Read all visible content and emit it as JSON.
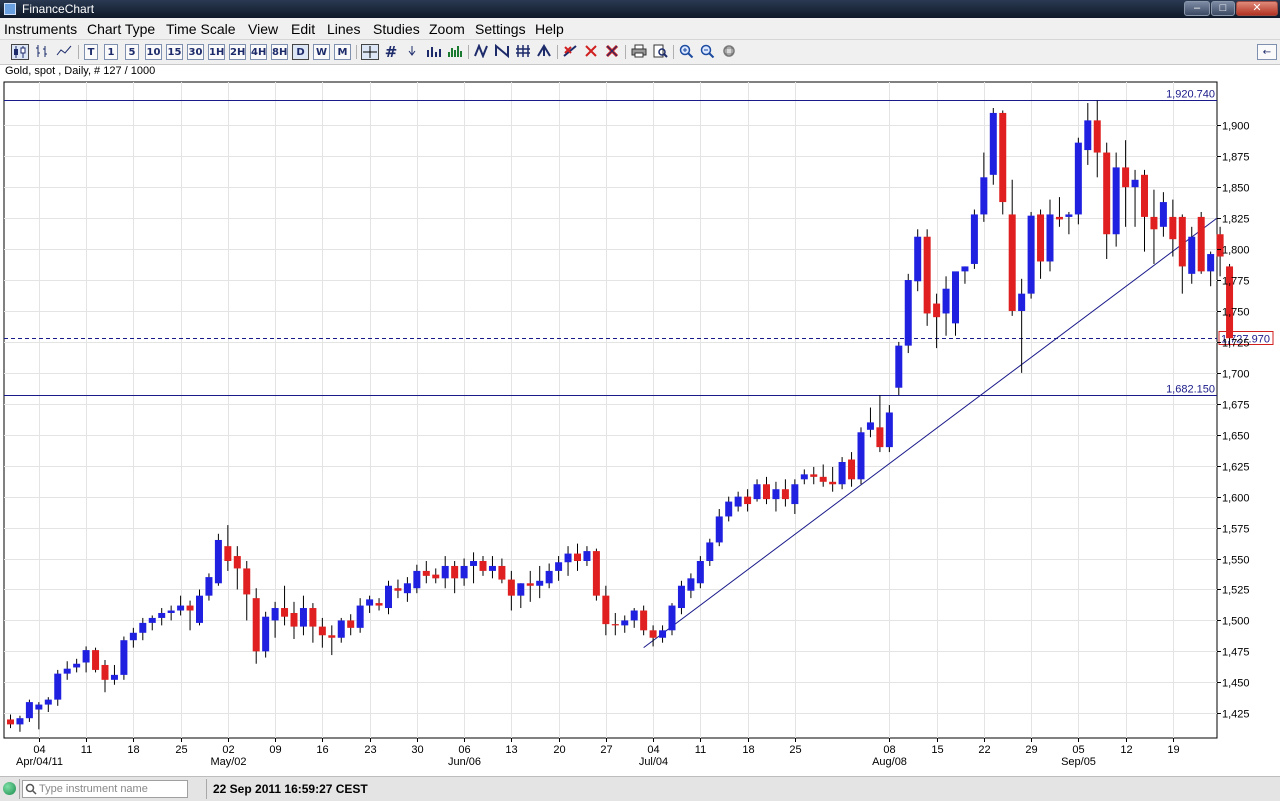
{
  "app": {
    "title": "FinanceChart"
  },
  "window_controls": {
    "minimize": "‒",
    "maximize": "□",
    "close": "✕"
  },
  "menu": [
    "Instruments",
    "Chart Type",
    "Time Scale",
    "View",
    "Edit",
    "Lines",
    "Studies",
    "Zoom",
    "Settings",
    "Help"
  ],
  "toolbar": {
    "timeframes": [
      "T",
      "1",
      "5",
      "10",
      "15",
      "30",
      "1H",
      "2H",
      "4H",
      "8H",
      "D",
      "W",
      "M"
    ],
    "selected_timeframe": "D",
    "dock_glyph": "←"
  },
  "instrument_info": "Gold, spot , Daily, # 127 / 1000",
  "status": {
    "search_placeholder": "Type instrument name",
    "datetime": "22 Sep 2011 16:59:27 CEST"
  },
  "chart_data": {
    "type": "candlestick",
    "instrument": "Gold, spot",
    "timeframe": "Daily",
    "up_color": "#2020e0",
    "down_color": "#e02020",
    "ylim": [
      1405,
      1935
    ],
    "y_ticks": [
      1425,
      1450,
      1475,
      1500,
      1525,
      1550,
      1575,
      1600,
      1625,
      1650,
      1675,
      1700,
      1725,
      1750,
      1775,
      1800,
      1825,
      1850,
      1875,
      1900
    ],
    "x_ticks": [
      {
        "i": 3,
        "label": "04"
      },
      {
        "i": 8,
        "label": "11"
      },
      {
        "i": 13,
        "label": "18"
      },
      {
        "i": 18,
        "label": "25"
      },
      {
        "i": 23,
        "label": "02"
      },
      {
        "i": 28,
        "label": "09"
      },
      {
        "i": 33,
        "label": "16"
      },
      {
        "i": 38,
        "label": "23"
      },
      {
        "i": 43,
        "label": "30"
      },
      {
        "i": 48,
        "label": "06"
      },
      {
        "i": 53,
        "label": "13"
      },
      {
        "i": 58,
        "label": "20"
      },
      {
        "i": 63,
        "label": "27"
      },
      {
        "i": 68,
        "label": "04"
      },
      {
        "i": 73,
        "label": "11"
      },
      {
        "i": 78,
        "label": "18"
      },
      {
        "i": 83,
        "label": "25"
      },
      {
        "i": 93,
        "label": "08"
      },
      {
        "i": 98,
        "label": "15"
      },
      {
        "i": 103,
        "label": "22"
      },
      {
        "i": 108,
        "label": "29"
      },
      {
        "i": 113,
        "label": "05"
      },
      {
        "i": 118,
        "label": "12"
      },
      {
        "i": 123,
        "label": "19"
      }
    ],
    "month_labels": [
      {
        "i": 3,
        "label": "Apr/04/11"
      },
      {
        "i": 23,
        "label": "May/02"
      },
      {
        "i": 48,
        "label": "Jun/06"
      },
      {
        "i": 68,
        "label": "Jul/04"
      },
      {
        "i": 93,
        "label": "Aug/08"
      },
      {
        "i": 113,
        "label": "Sep/05"
      }
    ],
    "horizontal_lines": [
      {
        "value": 1920.74,
        "label": "1,920.740",
        "style": "solid"
      },
      {
        "value": 1682.15,
        "label": "1,682.150",
        "style": "solid"
      },
      {
        "value": 1727.97,
        "label": "1,727.970",
        "style": "dashed"
      }
    ],
    "trendline": {
      "from": {
        "i": 67,
        "value": 1478
      },
      "to": {
        "i": 127,
        "value": 1825
      }
    },
    "candles": [
      [
        1420,
        1424,
        1413,
        1416
      ],
      [
        1416,
        1423,
        1410,
        1421
      ],
      [
        1421,
        1436,
        1418,
        1434
      ],
      [
        1428,
        1434,
        1412,
        1432
      ],
      [
        1432,
        1438,
        1426,
        1436
      ],
      [
        1436,
        1460,
        1431,
        1457
      ],
      [
        1457,
        1467,
        1452,
        1461
      ],
      [
        1462,
        1469,
        1458,
        1465
      ],
      [
        1466,
        1479,
        1458,
        1476
      ],
      [
        1476,
        1478,
        1458,
        1460
      ],
      [
        1464,
        1468,
        1442,
        1452
      ],
      [
        1452,
        1464,
        1448,
        1456
      ],
      [
        1456,
        1487,
        1452,
        1484
      ],
      [
        1484,
        1494,
        1478,
        1490
      ],
      [
        1490,
        1502,
        1484,
        1498
      ],
      [
        1498,
        1504,
        1492,
        1502
      ],
      [
        1502,
        1510,
        1496,
        1506
      ],
      [
        1506,
        1512,
        1500,
        1508
      ],
      [
        1508,
        1520,
        1504,
        1512
      ],
      [
        1512,
        1516,
        1492,
        1508
      ],
      [
        1498,
        1525,
        1496,
        1520
      ],
      [
        1520,
        1538,
        1516,
        1535
      ],
      [
        1530,
        1570,
        1528,
        1565
      ],
      [
        1560,
        1577,
        1540,
        1548
      ],
      [
        1552,
        1560,
        1525,
        1542
      ],
      [
        1542,
        1548,
        1500,
        1521
      ],
      [
        1518,
        1526,
        1465,
        1475
      ],
      [
        1475,
        1507,
        1470,
        1503
      ],
      [
        1500,
        1515,
        1486,
        1510
      ],
      [
        1510,
        1528,
        1496,
        1503
      ],
      [
        1506,
        1515,
        1485,
        1495
      ],
      [
        1495,
        1520,
        1488,
        1510
      ],
      [
        1510,
        1514,
        1482,
        1495
      ],
      [
        1495,
        1502,
        1478,
        1488
      ],
      [
        1488,
        1496,
        1472,
        1486
      ],
      [
        1486,
        1502,
        1482,
        1500
      ],
      [
        1500,
        1505,
        1488,
        1494
      ],
      [
        1494,
        1518,
        1490,
        1512
      ],
      [
        1512,
        1520,
        1506,
        1517
      ],
      [
        1514,
        1518,
        1508,
        1512
      ],
      [
        1510,
        1532,
        1505,
        1528
      ],
      [
        1526,
        1533,
        1518,
        1524
      ],
      [
        1522,
        1535,
        1515,
        1530
      ],
      [
        1526,
        1545,
        1522,
        1540
      ],
      [
        1540,
        1548,
        1530,
        1536
      ],
      [
        1537,
        1542,
        1530,
        1534
      ],
      [
        1534,
        1552,
        1526,
        1544
      ],
      [
        1544,
        1548,
        1522,
        1534
      ],
      [
        1534,
        1550,
        1528,
        1544
      ],
      [
        1544,
        1555,
        1530,
        1548
      ],
      [
        1548,
        1552,
        1536,
        1540
      ],
      [
        1540,
        1552,
        1534,
        1544
      ],
      [
        1544,
        1550,
        1530,
        1533
      ],
      [
        1533,
        1540,
        1508,
        1520
      ],
      [
        1520,
        1530,
        1510,
        1530
      ],
      [
        1530,
        1540,
        1515,
        1528
      ],
      [
        1528,
        1544,
        1518,
        1532
      ],
      [
        1530,
        1546,
        1526,
        1540
      ],
      [
        1540,
        1552,
        1532,
        1547
      ],
      [
        1547,
        1560,
        1536,
        1554
      ],
      [
        1554,
        1562,
        1540,
        1548
      ],
      [
        1548,
        1560,
        1544,
        1556
      ],
      [
        1556,
        1558,
        1516,
        1520
      ],
      [
        1520,
        1528,
        1488,
        1497
      ],
      [
        1497,
        1506,
        1488,
        1496
      ],
      [
        1496,
        1504,
        1490,
        1500
      ],
      [
        1500,
        1510,
        1494,
        1508
      ],
      [
        1508,
        1512,
        1488,
        1492
      ],
      [
        1492,
        1496,
        1479,
        1486
      ],
      [
        1486,
        1496,
        1482,
        1492
      ],
      [
        1492,
        1514,
        1488,
        1512
      ],
      [
        1510,
        1532,
        1505,
        1528
      ],
      [
        1524,
        1538,
        1518,
        1534
      ],
      [
        1530,
        1552,
        1526,
        1548
      ],
      [
        1548,
        1566,
        1544,
        1563
      ],
      [
        1563,
        1590,
        1560,
        1584
      ],
      [
        1584,
        1600,
        1580,
        1596
      ],
      [
        1592,
        1604,
        1588,
        1600
      ],
      [
        1600,
        1606,
        1588,
        1594
      ],
      [
        1598,
        1614,
        1596,
        1610
      ],
      [
        1610,
        1616,
        1594,
        1598
      ],
      [
        1598,
        1612,
        1588,
        1606
      ],
      [
        1606,
        1614,
        1592,
        1598
      ],
      [
        1594,
        1614,
        1586,
        1610
      ],
      [
        1614,
        1622,
        1610,
        1618
      ],
      [
        1618,
        1624,
        1610,
        1616
      ],
      [
        1616,
        1626,
        1608,
        1612
      ],
      [
        1612,
        1624,
        1604,
        1610
      ],
      [
        1610,
        1632,
        1606,
        1628
      ],
      [
        1630,
        1636,
        1608,
        1614
      ],
      [
        1614,
        1656,
        1610,
        1652
      ],
      [
        1654,
        1672,
        1648,
        1660
      ],
      [
        1656,
        1682,
        1636,
        1640
      ],
      [
        1640,
        1674,
        1636,
        1668
      ],
      [
        1688,
        1725,
        1682,
        1722
      ],
      [
        1722,
        1780,
        1716,
        1775
      ],
      [
        1774,
        1816,
        1766,
        1810
      ],
      [
        1810,
        1816,
        1738,
        1748
      ],
      [
        1756,
        1764,
        1720,
        1745
      ],
      [
        1748,
        1778,
        1730,
        1768
      ],
      [
        1740,
        1780,
        1730,
        1782
      ],
      [
        1782,
        1786,
        1772,
        1786
      ],
      [
        1788,
        1832,
        1784,
        1828
      ],
      [
        1828,
        1878,
        1822,
        1858
      ],
      [
        1860,
        1914,
        1852,
        1910
      ],
      [
        1910,
        1912,
        1828,
        1838
      ],
      [
        1828,
        1856,
        1746,
        1750
      ],
      [
        1750,
        1776,
        1700,
        1764
      ],
      [
        1764,
        1830,
        1760,
        1827
      ],
      [
        1828,
        1832,
        1776,
        1790
      ],
      [
        1790,
        1840,
        1782,
        1828
      ],
      [
        1826,
        1842,
        1818,
        1824
      ],
      [
        1826,
        1830,
        1812,
        1828
      ],
      [
        1828,
        1890,
        1820,
        1886
      ],
      [
        1880,
        1918,
        1868,
        1904
      ],
      [
        1904,
        1920,
        1858,
        1878
      ],
      [
        1878,
        1886,
        1792,
        1812
      ],
      [
        1812,
        1878,
        1802,
        1866
      ],
      [
        1866,
        1888,
        1818,
        1850
      ],
      [
        1850,
        1864,
        1818,
        1856
      ],
      [
        1860,
        1864,
        1798,
        1826
      ],
      [
        1826,
        1848,
        1788,
        1816
      ],
      [
        1818,
        1846,
        1810,
        1838
      ],
      [
        1826,
        1840,
        1794,
        1808
      ],
      [
        1826,
        1828,
        1764,
        1786
      ],
      [
        1780,
        1818,
        1772,
        1810
      ],
      [
        1826,
        1830,
        1780,
        1782
      ],
      [
        1782,
        1798,
        1770,
        1796
      ],
      [
        1812,
        1818,
        1778,
        1794
      ],
      [
        1786,
        1788,
        1722,
        1728
      ]
    ]
  }
}
